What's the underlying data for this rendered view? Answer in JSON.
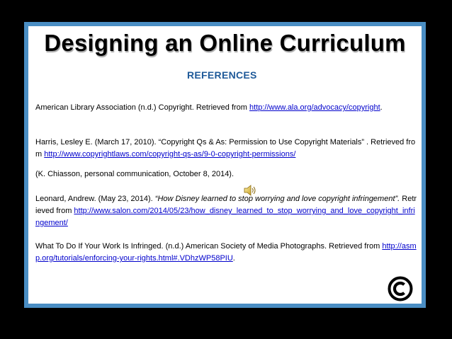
{
  "slide": {
    "title": "Designing an Online Curriculum",
    "subtitle": "REFERENCES"
  },
  "references": [
    {
      "text_before": "American Library Association (n.d.)  Copyright.  Retrieved from ",
      "link": "http://www.ala.org/advocacy/copyright",
      "text_after": "."
    },
    {
      "text_before": "Harris, Lesley E.  (March 17, 2010).  “Copyright Qs & As:  Permission to Use Copyright Materials” . Retrieved from ",
      "link": "http://www.copyrightlaws.com/copyright-qs-as/9-0-copyright-permissions/",
      "text_after": ""
    },
    {
      "text_before": "(K. Chiasson, personal communication, October 8, 2014).",
      "link": "",
      "text_after": ""
    },
    {
      "text_before": "Leonard, Andrew.  (May 23, 2014).  ",
      "italic": "“How Disney learned to stop worrying and love copyright infringement”.",
      "text_mid": " Retrieved from ",
      "link": "http://www.salon.com/2014/05/23/how_disney_learned_to_stop_worrying_and_love_copyright_infringement/",
      "text_after": ""
    },
    {
      "text_before": "What To Do If Your Work Is Infringed.  (n.d.)  American Society of Media Photographs.  Retrieved from ",
      "link": "http://asmp.org/tutorials/enforcing-your-rights.html#.VDhzWP58PIU",
      "text_after": "."
    }
  ],
  "icons": {
    "audio": "speaker-icon",
    "copyright": "copyright-icon"
  },
  "colors": {
    "background": "#000000",
    "frame": "#4a8ec4",
    "slide": "#ffffff",
    "subtitle": "#1f5a99",
    "link": "#0000cc"
  }
}
